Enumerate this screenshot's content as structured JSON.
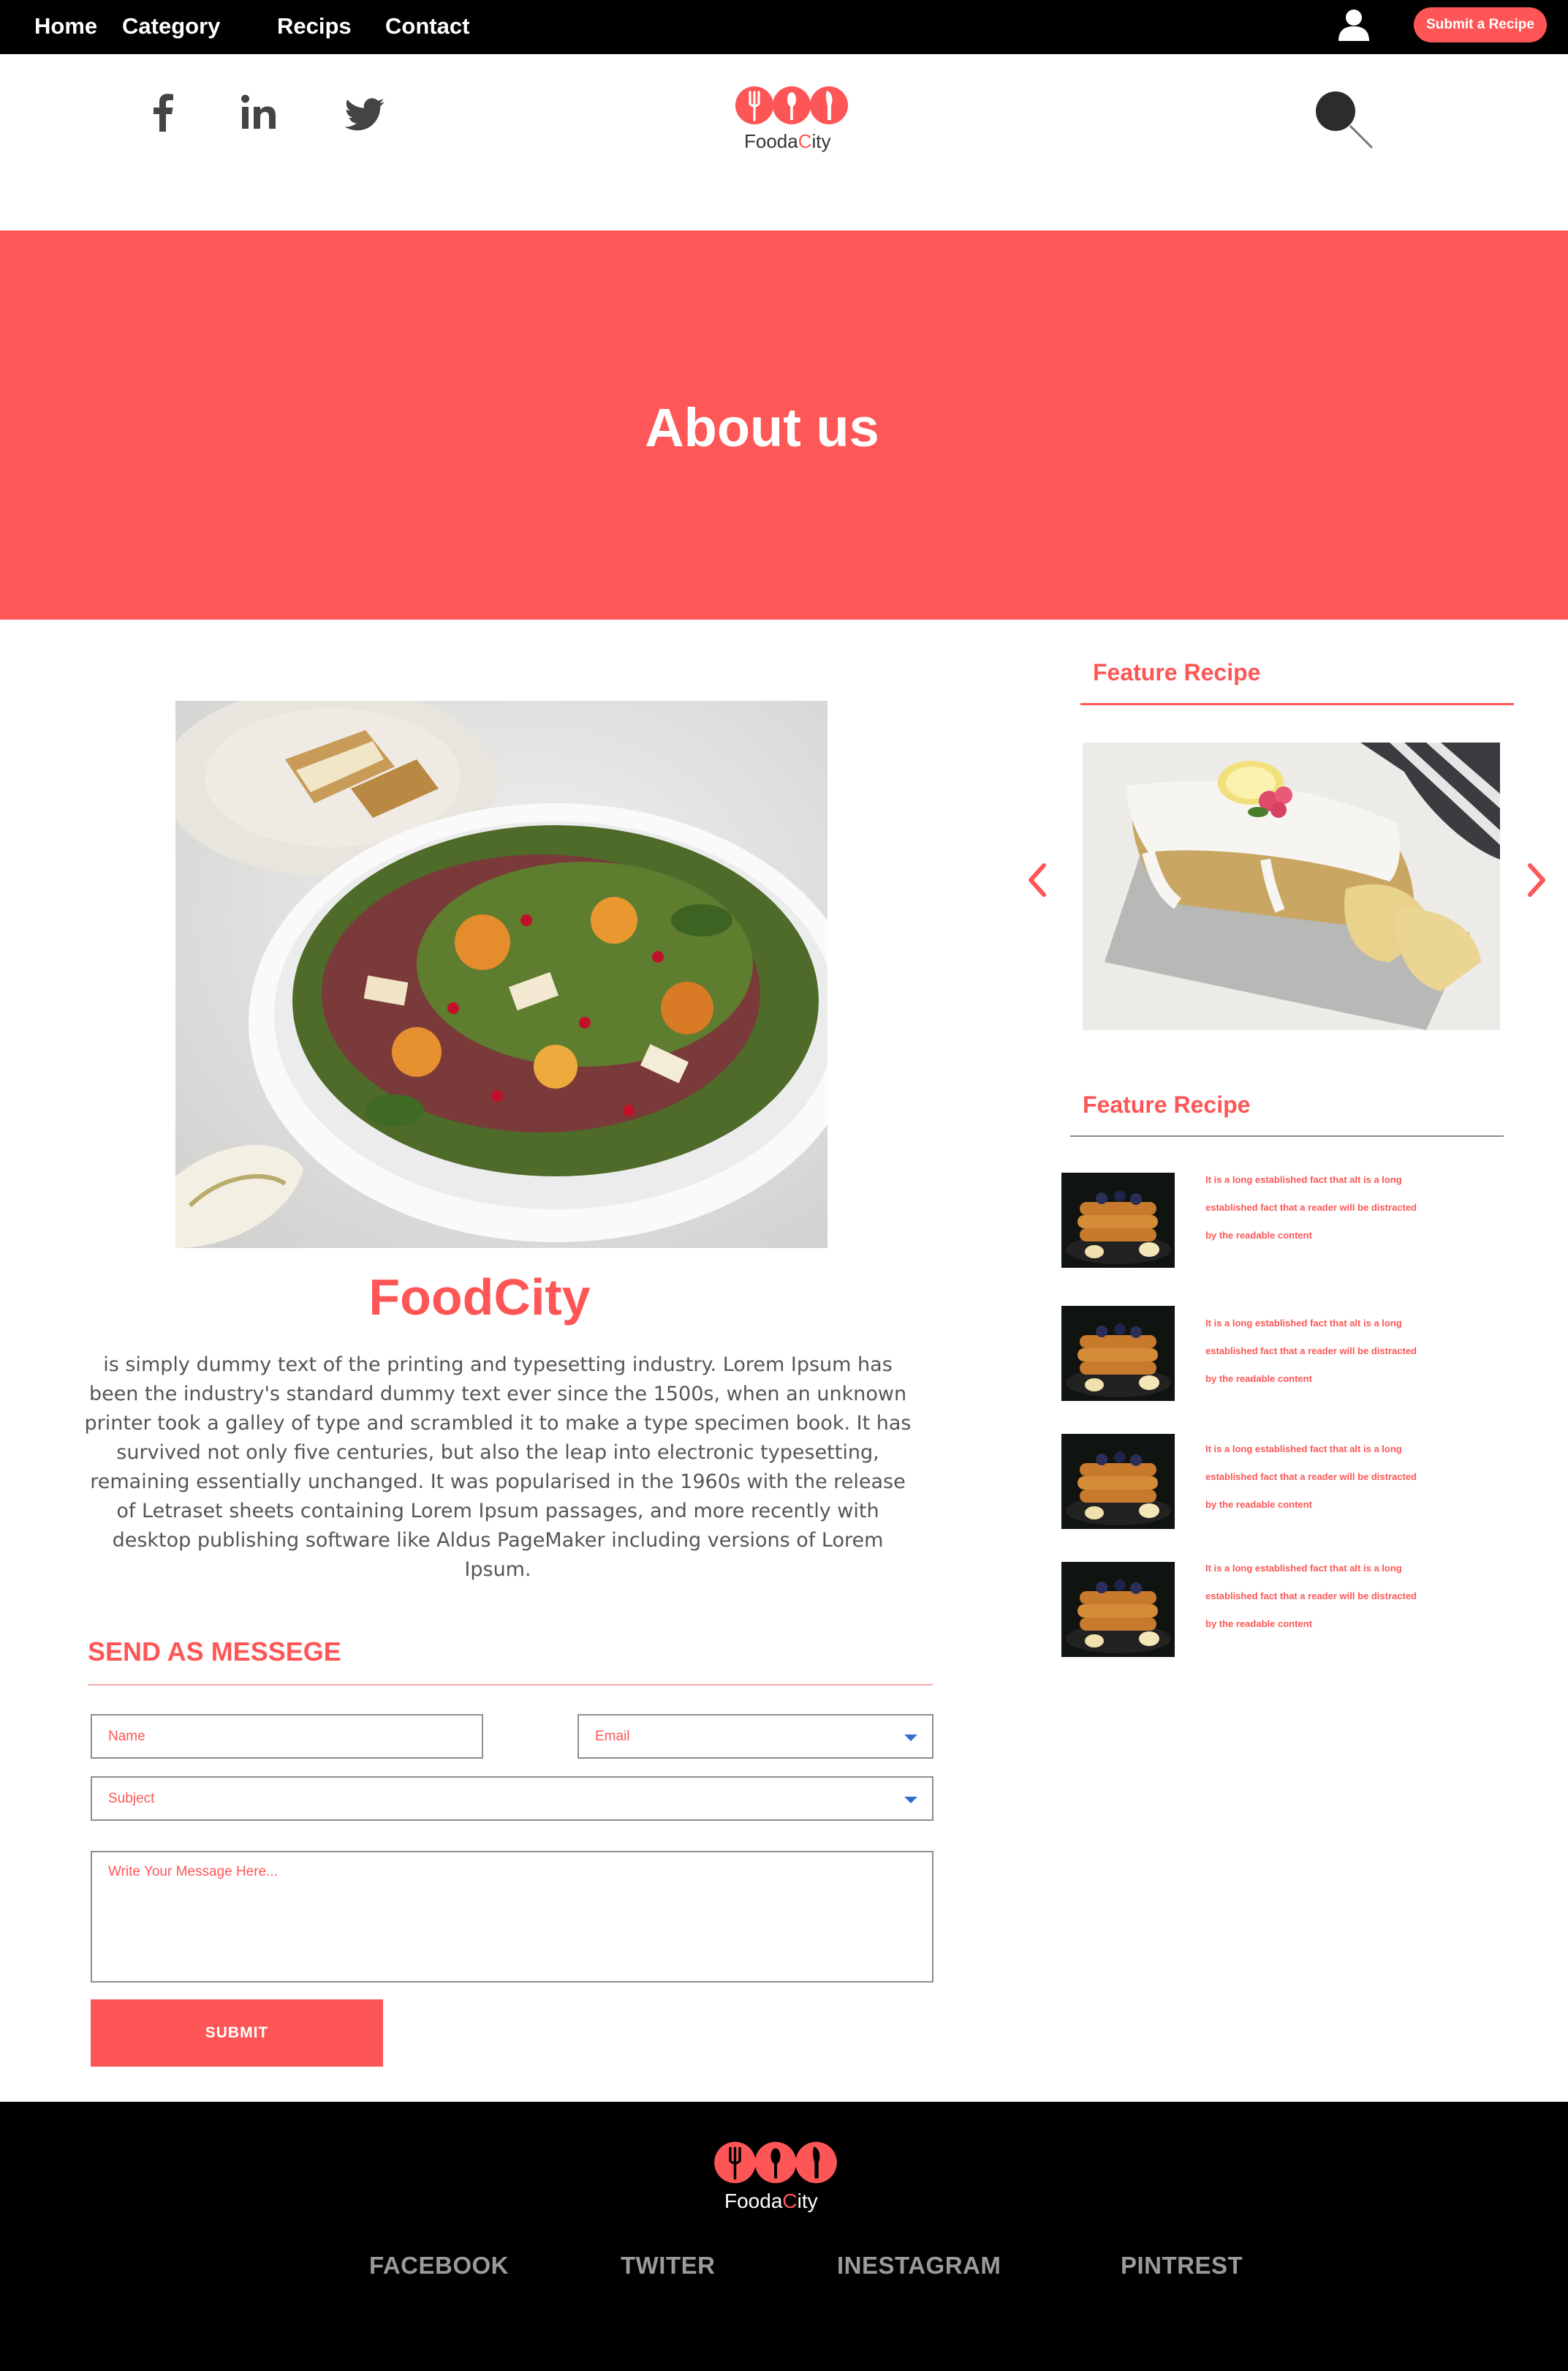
{
  "nav": {
    "links": [
      "Home",
      "Category",
      "Recips",
      "Contact"
    ],
    "submit_label": "Submit a Recipe"
  },
  "header": {
    "social_icons": [
      "facebook-icon",
      "linkedin-icon",
      "twitter-icon"
    ],
    "logo": {
      "part1": "Fooda",
      "part2": "C",
      "part3": "ity"
    }
  },
  "hero": {
    "title": "About us"
  },
  "about": {
    "brand": "FoodCity",
    "text": "is simply dummy text of the printing and typesetting industry. Lorem Ipsum has been the industry's standard dummy text ever since the 1500s, when an unknown printer took a galley of type and scrambled it to make a type specimen book. It has survived not only five centuries, but also the leap into electronic typesetting, remaining essentially unchanged. It was popularised in the 1960s with the release of Letraset sheets containing Lorem Ipsum passages, and more recently with desktop publishing software like Aldus PageMaker including versions of Lorem Ipsum."
  },
  "contact": {
    "title": "SEND AS MESSEGE",
    "name_placeholder": "Name",
    "email_placeholder": "Email",
    "subject_placeholder": "Subject",
    "message_placeholder": "Write Your Message Here...",
    "submit_label": "SUBMIT"
  },
  "sidebar": {
    "feature_title_1": "Feature Recipe",
    "feature_title_2": "Feature Recipe",
    "items": [
      {
        "text": "It is a long established fact that alt is a long established fact that a reader will be distracted by the readable content"
      },
      {
        "text": "It is a long established fact that alt is a long established fact that a reader will be distracted by the readable content"
      },
      {
        "text": "It is a long established fact that alt is a long established fact that a reader will be distracted by the readable content"
      },
      {
        "text": "It is a long established fact that alt is a long established fact that a reader will be distracted by the readable content"
      }
    ]
  },
  "footer": {
    "logo": {
      "part1": "Fooda",
      "part2": "C",
      "part3": "ity"
    },
    "links": [
      "FACEBOOK",
      "TWITER",
      "INESTAGRAM",
      "PINTREST"
    ]
  },
  "colors": {
    "accent": "#fe5656",
    "nav_bg": "#000000",
    "hero_bg": "#fe5757"
  }
}
